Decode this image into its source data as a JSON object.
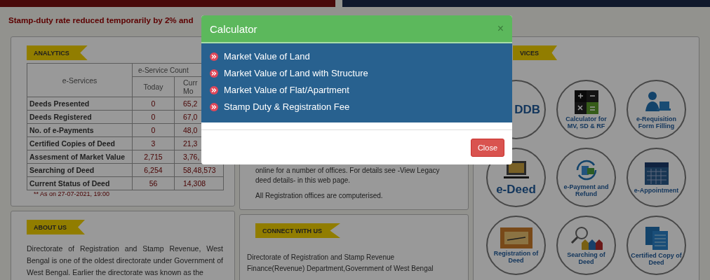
{
  "notice": "Stamp-duty rate reduced temporarily by 2% and",
  "analytics": {
    "ribbon": "ANALYTICS",
    "header_services": "e-Services",
    "header_count": "e-Service Count",
    "header_today": "Today",
    "header_column_3": [
      "Curr",
      "Mo"
    ],
    "rows": [
      {
        "service": "Deeds Presented",
        "today": "0",
        "column_3": "65,2"
      },
      {
        "service": "Deeds Registered",
        "today": "0",
        "column_3": "67,0"
      },
      {
        "service": "No. of e-Payments",
        "today": "0",
        "column_3": "48,0"
      },
      {
        "service": "Certified Copies of Deed",
        "today": "3",
        "column_3": "21,3"
      },
      {
        "service": "Assesment of Market Value",
        "today": "2,715",
        "column_3": "3,76,"
      },
      {
        "service": "Searching of Deed",
        "today": "6,254",
        "column_3": "58,48,573"
      },
      {
        "service": "Current Status of Deed",
        "today": "56",
        "column_3": "14,308"
      }
    ],
    "note": "** As on 27-07-2021, 19:00"
  },
  "about": {
    "ribbon": "ABOUT US",
    "text": "Directorate of Registration and Stamp Revenue, West Bengal is one of the oldest directorate under Government of West Bengal. Earlier the directorate was known as the"
  },
  "legacy": {
    "paragraphs": [
      "online for a number of offices. For details see -View Legacy deed details- in this web page.",
      "All Registration offices are computerised."
    ]
  },
  "connect": {
    "ribbon": "CONNECT WITH US",
    "lines": [
      "Directorate of Registration and Stamp Revenue",
      "Finance(Revenue) Department,Government of West Bengal"
    ]
  },
  "services": {
    "ribbon": "VICES",
    "items": [
      {
        "label": "DDB"
      },
      {
        "label": "Calculator for MV, SD & RF"
      },
      {
        "label": "e-Requisition Form Filling"
      },
      {
        "label": "e-Deed"
      },
      {
        "label": "e-Payment and Refund"
      },
      {
        "label": "e-Appointment"
      },
      {
        "label": "Registration of Deed"
      },
      {
        "label": "Searching of Deed"
      },
      {
        "label": "Certified Copy of Deed"
      }
    ]
  },
  "modal": {
    "title": "Calculator",
    "close_symbol": "×",
    "items": [
      "Market Value of Land",
      "Market Value of Land with Structure",
      "Market Value of Flat/Apartment",
      "Stamp Duty & Registration Fee"
    ],
    "button": "Close"
  }
}
